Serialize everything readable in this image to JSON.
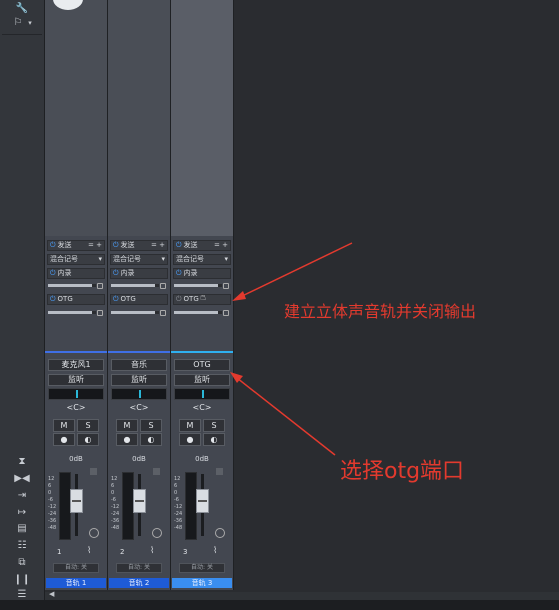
{
  "left_toolbar": {
    "top_icons": [
      "wrench-icon",
      "input-icon",
      "dropdown-arrow-icon"
    ],
    "bottom_icons": [
      "collapse-up-icon",
      "expand-horizontal-icon",
      "arrow-right-bar-icon",
      "arrow-bar-right-icon",
      "panel-icon",
      "keyboard-icon",
      "layers-icon",
      "bars-icon",
      "list-icon"
    ]
  },
  "strips": [
    {
      "send_label": "发送",
      "mix_label": "混合记号",
      "insert_label": "内录",
      "otg_label": "OTG",
      "input_name": "麦克风1",
      "monitor_label": "监听",
      "pan_label": "<C>",
      "mute_label": "M",
      "solo_label": "S",
      "level_label": "0dB",
      "number": "1",
      "auto_label": "自动: 关",
      "track_name": "音轨 1",
      "fader_level": 0.62
    },
    {
      "send_label": "发送",
      "mix_label": "混合记号",
      "insert_label": "内录",
      "otg_label": "OTG",
      "input_name": "音乐",
      "monitor_label": "监听",
      "pan_label": "<C>",
      "mute_label": "M",
      "solo_label": "S",
      "level_label": "0dB",
      "number": "2",
      "auto_label": "自动: 关",
      "track_name": "音轨 2",
      "fader_level": 0.62
    },
    {
      "send_label": "发送",
      "mix_label": "混合记号",
      "insert_label": "内录",
      "otg_label": "OTG",
      "input_name": "OTG",
      "monitor_label": "监听",
      "pan_label": "<C>",
      "mute_label": "M",
      "solo_label": "S",
      "level_label": "0dB",
      "number": "3",
      "auto_label": "自动: 关",
      "track_name": "音轨 3",
      "fader_level": 0.62
    }
  ],
  "fader_scale": [
    "12",
    "6",
    "0",
    "-6",
    "-12",
    "-24",
    "-36",
    "-48"
  ],
  "annotations": [
    {
      "text": "建立立体声音轨并关闭输出",
      "color": "#e33a2e"
    },
    {
      "text": "选择otg端口",
      "color": "#e33a2e"
    }
  ]
}
